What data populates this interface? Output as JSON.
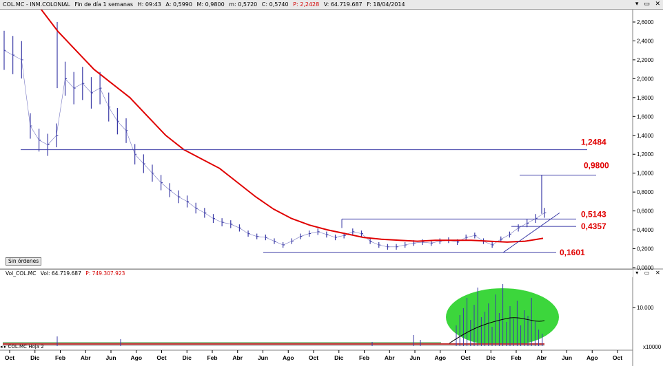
{
  "header": {
    "symbol": "COL.MC - INM.COLONIAL",
    "period": "Fin de día 1 semanas",
    "time": "H: 09:43",
    "open": "A: 0,5990",
    "high": "M: 0,9800",
    "low": "m: 0,5720",
    "close": "C: 0,5740",
    "pvalue": "P: 2,2428",
    "volume": "V: 64.719.687",
    "date": "F: 18/04/2014"
  },
  "volume_panel": {
    "title": "Vol_COL.MC",
    "vol": "Vol: 64.719.687",
    "p": "P: 749.307.923",
    "multiplier": "x10000",
    "tick": "10.000"
  },
  "status_label": "Sin órdenes",
  "tabs": {
    "left": "COL.MC",
    "right": "Hoja 2"
  },
  "levels": {
    "l1": "1,2484",
    "l2": "0,9800",
    "l3": "0,5143",
    "l4": "0,4357",
    "l5": "0,1601"
  },
  "y_ticks": [
    "2,6000",
    "2,4000",
    "2,2000",
    "2,0000",
    "1,8000",
    "1,6000",
    "1,4000",
    "1,2000",
    "1,0000",
    "0,8000",
    "0,6000",
    "0,4000",
    "0,2000",
    "0,0000"
  ],
  "x_ticks": [
    "Oct",
    "Dic",
    "Feb",
    "Abr",
    "Jun",
    "Ago",
    "Oct",
    "Dic",
    "Feb",
    "Abr",
    "Jun",
    "Ago",
    "Oct",
    "Dic",
    "Feb",
    "Abr",
    "Jun",
    "Ago",
    "Oct",
    "Dic",
    "Feb",
    "Abr",
    "Jun",
    "Ago",
    "Oct"
  ],
  "colors": {
    "ma": "#e00000",
    "lines": "#3a3aa6",
    "highlight": "#3cd63c",
    "label": "#e00000"
  },
  "chart_data": {
    "type": "line",
    "title": "COL.MC - INM.COLONIAL",
    "ylim": [
      0,
      2.7
    ],
    "close_series": [
      2.3,
      2.25,
      2.2,
      1.5,
      1.35,
      1.3,
      1.4,
      2.0,
      1.9,
      1.95,
      1.85,
      1.9,
      1.7,
      1.55,
      1.45,
      1.2,
      1.1,
      1.0,
      0.9,
      0.82,
      0.75,
      0.7,
      0.63,
      0.58,
      0.52,
      0.48,
      0.46,
      0.42,
      0.36,
      0.33,
      0.32,
      0.28,
      0.24,
      0.28,
      0.33,
      0.36,
      0.38,
      0.35,
      0.32,
      0.34,
      0.38,
      0.36,
      0.28,
      0.24,
      0.22,
      0.22,
      0.24,
      0.26,
      0.27,
      0.26,
      0.28,
      0.29,
      0.27,
      0.32,
      0.34,
      0.28,
      0.24,
      0.3,
      0.35,
      0.42,
      0.47,
      0.52,
      0.58
    ],
    "moving_average": [
      2.75,
      2.5,
      2.3,
      2.1,
      1.95,
      1.8,
      1.6,
      1.4,
      1.25,
      1.15,
      1.05,
      0.9,
      0.75,
      0.62,
      0.52,
      0.45,
      0.4,
      0.36,
      0.32,
      0.3,
      0.29,
      0.28,
      0.29,
      0.29,
      0.29,
      0.28,
      0.27,
      0.28,
      0.31
    ],
    "volume_annotation": "highlighted high-volume zone Oct–Abr"
  }
}
